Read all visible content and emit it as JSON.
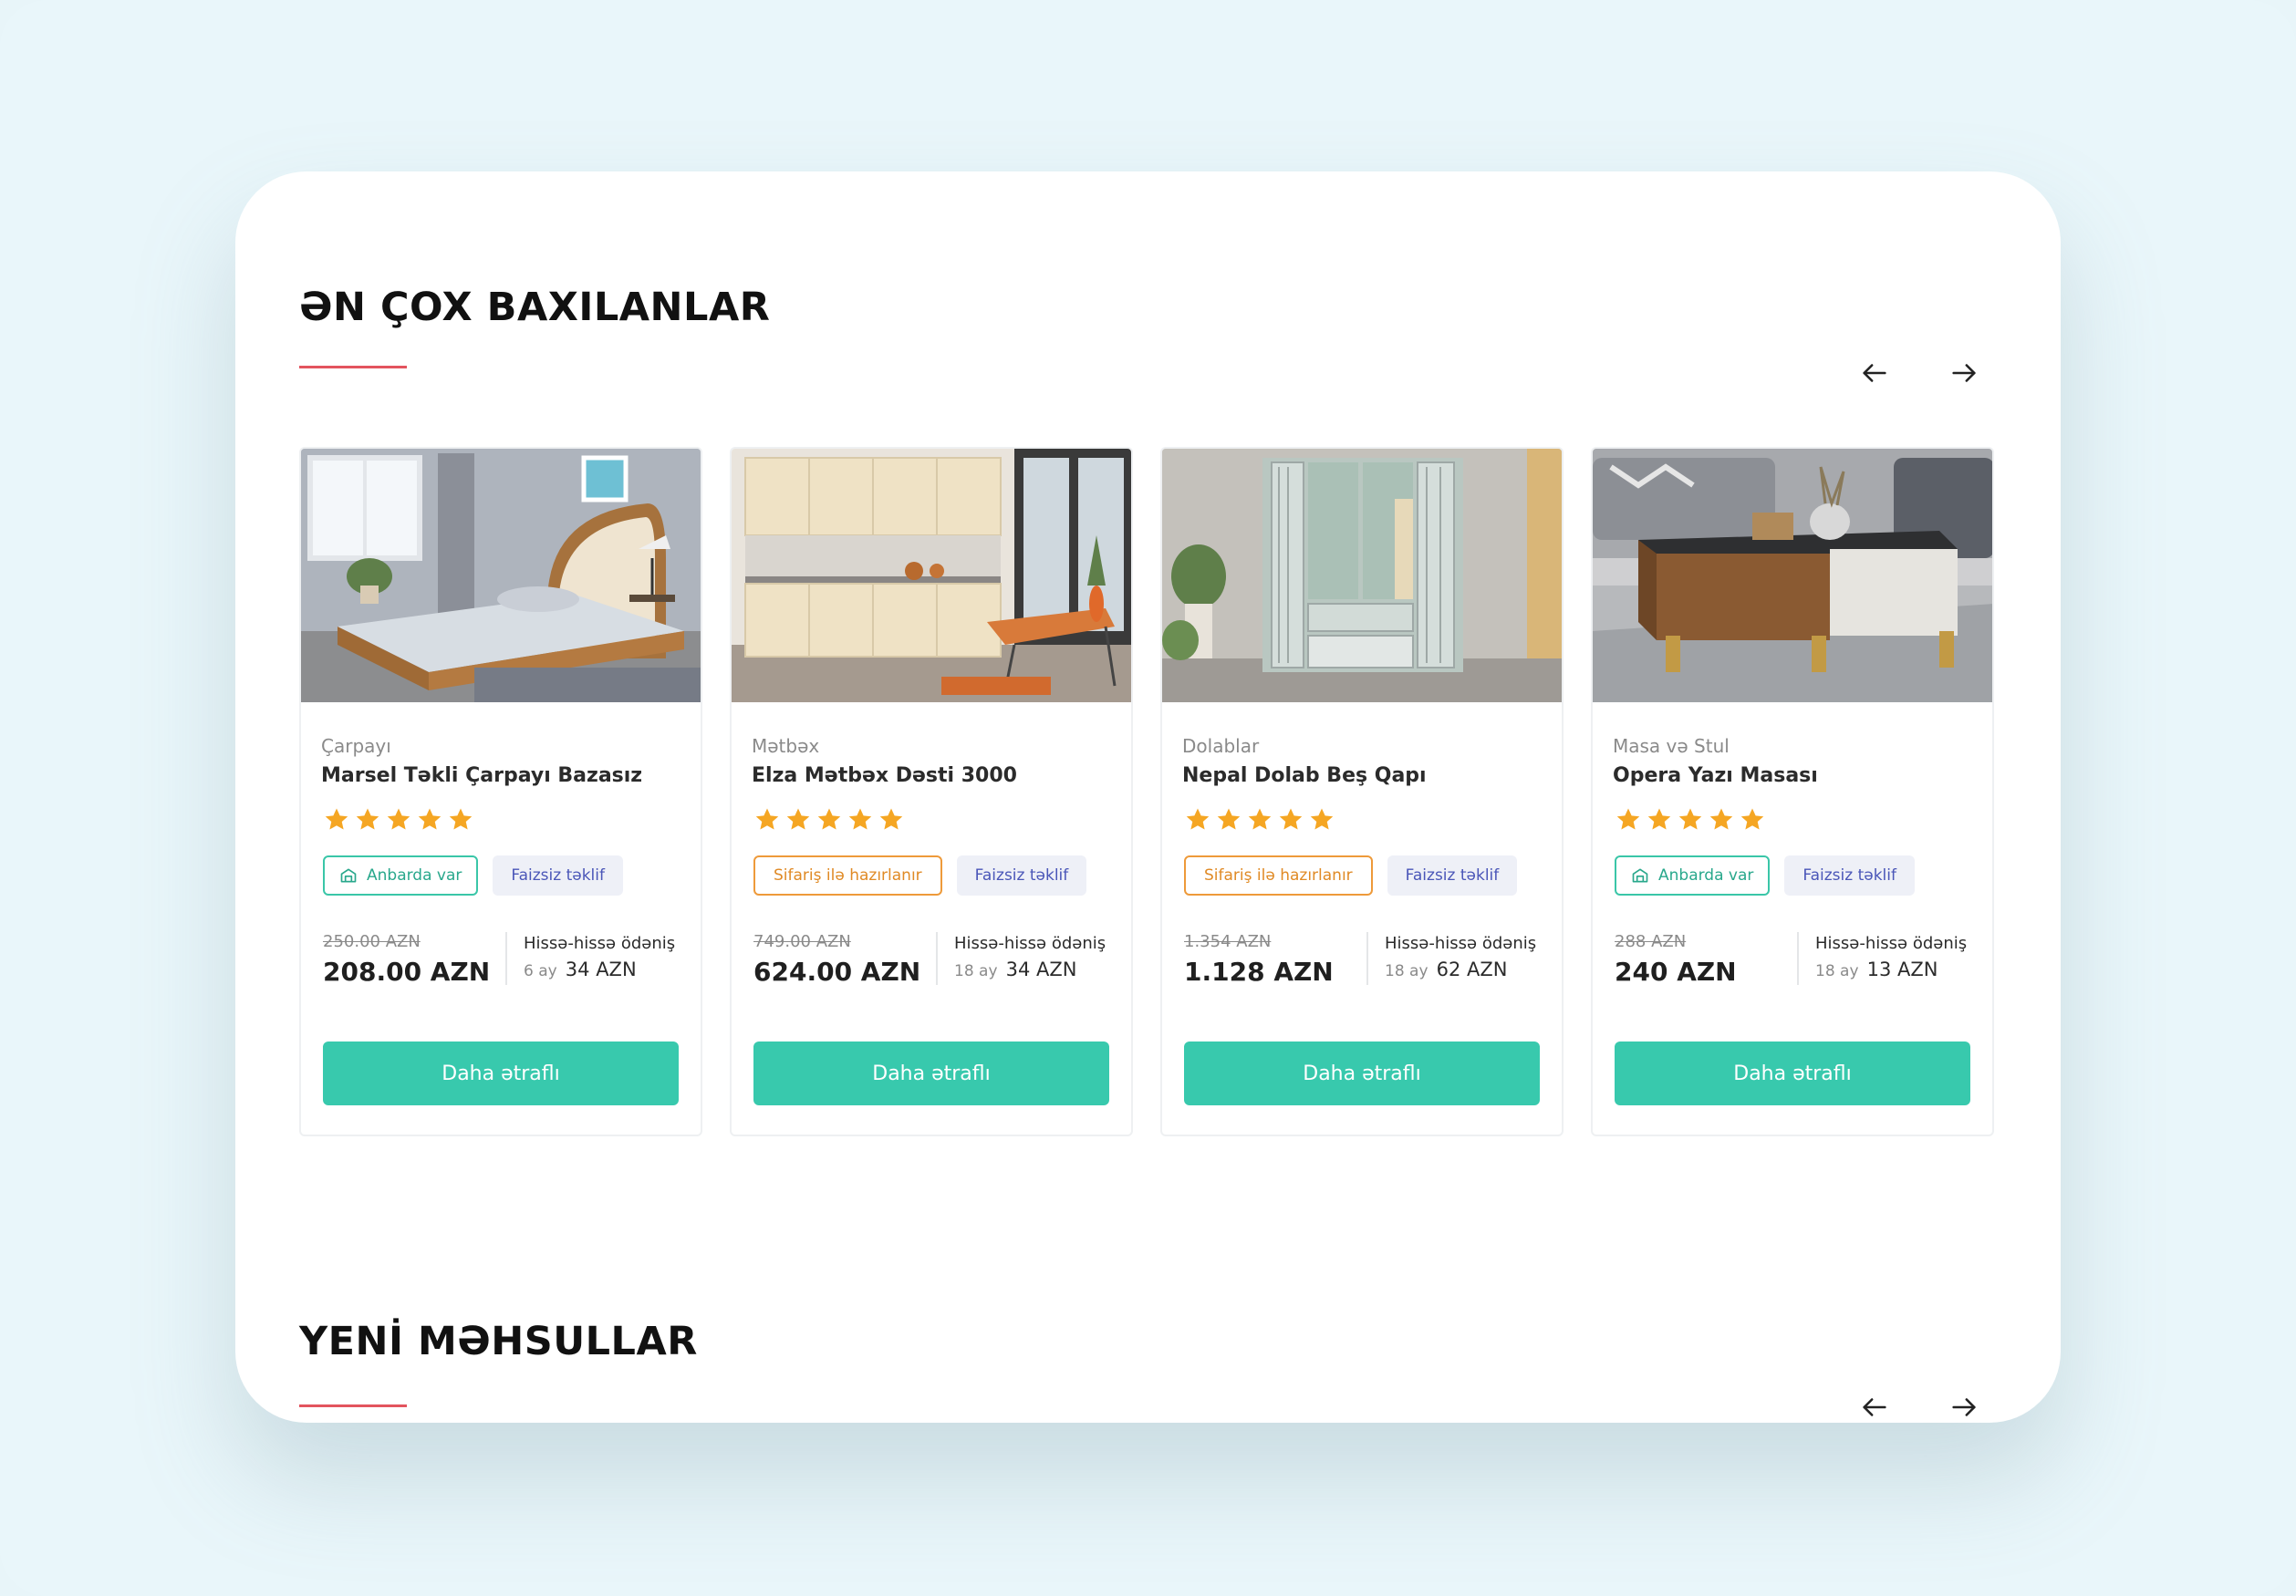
{
  "sections": {
    "most_viewed": {
      "title": "ƏN ÇOX BAXILANLAR"
    },
    "new_products": {
      "title": "YENİ MƏHSULLAR"
    }
  },
  "colors": {
    "accent": "#38c9ad",
    "underline": "#e3545e",
    "star": "#f5a623",
    "stock_badge": "#3ac6a8",
    "order_badge": "#ee9a3a",
    "offer_badge_text": "#4a56b8"
  },
  "products": [
    {
      "category": "Çarpayı",
      "name": "Marsel Təkli Çarpayı Bazasız",
      "rating": 5,
      "availability": "Anbarda var",
      "availability_icon": "warehouse-icon",
      "offer": "Faizsiz təklif",
      "old_price": "250.00 AZN",
      "price": "208.00 AZN",
      "installment_title": "Hissə-hissə ödəniş",
      "installment_months": "6 ay",
      "installment_amount": "34 AZN",
      "button": "Daha ətraflı"
    },
    {
      "category": "Mətbəx",
      "name": "Elza Mətbəx Dəsti 3000",
      "rating": 5,
      "availability": "Sifariş ilə hazırlanır",
      "offer": "Faizsiz təklif",
      "old_price": "749.00 AZN",
      "price": "624.00 AZN",
      "installment_title": "Hissə-hissə ödəniş",
      "installment_months": "18 ay",
      "installment_amount": "34 AZN",
      "button": "Daha ətraflı"
    },
    {
      "category": "Dolablar",
      "name": "Nepal Dolab Beş Qapı",
      "rating": 5,
      "availability": "Sifariş ilə hazırlanır",
      "offer": "Faizsiz təklif",
      "old_price": "1.354 AZN",
      "price": "1.128 AZN",
      "installment_title": "Hissə-hissə ödəniş",
      "installment_months": "18 ay",
      "installment_amount": "62 AZN",
      "button": "Daha ətraflı"
    },
    {
      "category": "Masa və Stul",
      "name": "Opera Yazı Masası",
      "rating": 5,
      "availability": "Anbarda var",
      "availability_icon": "warehouse-icon",
      "offer": "Faizsiz təklif",
      "old_price": "288 AZN",
      "price": "240 AZN",
      "installment_title": "Hissə-hissə ödəniş",
      "installment_months": "18 ay",
      "installment_amount": "13 AZN",
      "button": "Daha ətraflı"
    }
  ]
}
